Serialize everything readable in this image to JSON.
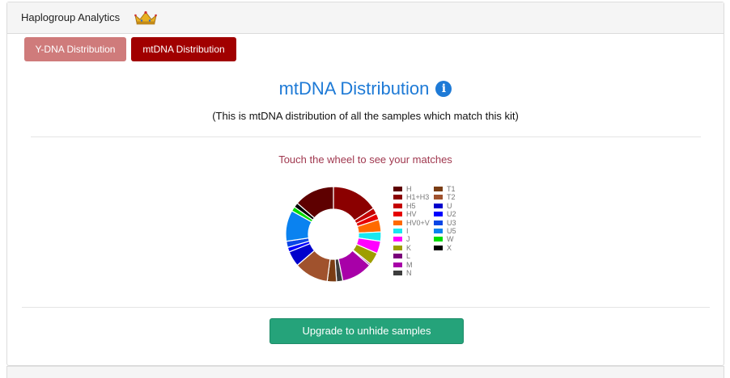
{
  "header": {
    "title": "Haplogroup Analytics",
    "crown_icon": "crown-icon"
  },
  "tabs": [
    {
      "label": "Y-DNA Distribution",
      "color": "#cf7b7b"
    },
    {
      "label": "mtDNA Distribution",
      "color": "#a10000"
    }
  ],
  "main": {
    "title": "mtDNA Distribution",
    "info_icon": "info-icon",
    "subtitle": "(This is mtDNA distribution of all the samples which match this kit)",
    "touch_prompt": "Touch the wheel to see your matches"
  },
  "chart_data": {
    "type": "pie",
    "variant": "doughnut",
    "legend_position": "right",
    "categories": [
      "H",
      "H1+H3",
      "H5",
      "HV",
      "HV0+V",
      "I",
      "J",
      "K",
      "L",
      "M",
      "N",
      "T1",
      "T2",
      "U",
      "U2",
      "U3",
      "U5",
      "W",
      "X"
    ],
    "values": [
      13,
      15,
      2,
      2,
      4,
      3,
      4,
      4,
      0.5,
      10,
      2,
      3,
      11,
      5,
      1.5,
      2,
      10,
      1.5,
      1.5
    ],
    "colors": [
      "#5e0000",
      "#8b0000",
      "#c40000",
      "#e60000",
      "#ff6a00",
      "#18e8f0",
      "#ff00ff",
      "#9e9e00",
      "#7a007a",
      "#a800a8",
      "#3d3d3d",
      "#7a3d14",
      "#a0522d",
      "#0000cc",
      "#0000ff",
      "#0a46e6",
      "#0a82f0",
      "#00dd00",
      "#000000"
    ],
    "start_at": "H1+H3",
    "title": ""
  },
  "actions": {
    "upgrade_label": "Upgrade to unhide samples"
  }
}
